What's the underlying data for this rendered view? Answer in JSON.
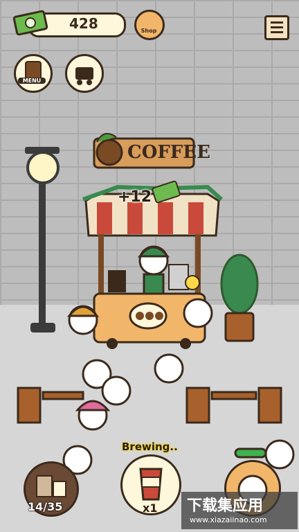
{
  "hud": {
    "money": "428",
    "shop_badge": "Shop",
    "menu_badge": "MENU"
  },
  "scene": {
    "shop_sign": "COFFEE",
    "bonus_popup": "+12"
  },
  "bottom": {
    "brewing_status": "Brewing..",
    "cup_count": "x1",
    "capacity": "14/35"
  },
  "watermark": {
    "title": "下载集应用",
    "url": "www.xiazaiinao.com"
  },
  "colors": {
    "outline": "#3b2a1c",
    "cream": "#fff7dc",
    "awning_red": "#c94a3a",
    "cart_orange": "#f2b66a",
    "tree_green": "#3a8a4f",
    "money_green": "#6dbb4f"
  }
}
